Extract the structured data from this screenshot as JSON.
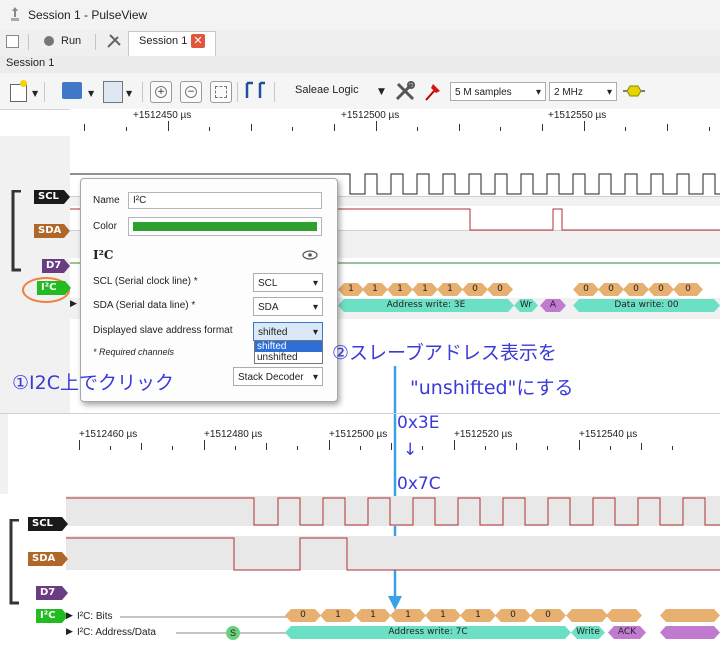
{
  "window": {
    "title": "Session 1 - PulseView"
  },
  "tabs": {
    "run_label": "Run",
    "session_tab": "Session 1"
  },
  "session_bar": {
    "label": "Session 1"
  },
  "toolbar": {
    "device": "Saleae Logic",
    "samples": "5 M samples",
    "rate": "2 MHz"
  },
  "top_ruler": {
    "ticks": [
      "+1512450 µs",
      "+1512500 µs",
      "+1512550 µs"
    ]
  },
  "top_traces": {
    "scl": "SCL",
    "sda": "SDA",
    "d7": "D7",
    "i2c": "I²C",
    "bits": [
      "1",
      "1",
      "1",
      "1",
      "1",
      "0",
      "0",
      "0",
      "0",
      "0",
      "0",
      "0"
    ],
    "address": "Address write: 3E",
    "wr": "Wr",
    "ack": "A",
    "data": "Data write: 00"
  },
  "popup": {
    "name_label": "Name",
    "name_value": "I²C",
    "color_label": "Color",
    "color_value": "#2ea02e",
    "decoder_title": "I²C",
    "scl_label": "SCL (Serial clock line) *",
    "scl_value": "SCL",
    "sda_label": "SDA (Serial data line) *",
    "sda_value": "SDA",
    "addr_label": "Displayed slave address format",
    "addr_value": "shifted",
    "options": [
      "shifted",
      "unshifted"
    ],
    "required": "* Required channels",
    "stack_button": "Stack Decoder"
  },
  "annotations": {
    "step1": "①I2C上でクリック",
    "step2_line1": "②スレーブアドレス表示を",
    "step2_line2": "\"unshifted\"にする",
    "from_value": "0x3E",
    "arrow": "↓",
    "to_value": "0x7C"
  },
  "bottom_ruler": {
    "ticks": [
      "+1512460 µs",
      "+1512480 µs",
      "+1512500 µs",
      "+1512520 µs",
      "+1512540 µs"
    ]
  },
  "bottom_traces": {
    "scl": "SCL",
    "sda": "SDA",
    "d7": "D7",
    "i2c": "I²C",
    "row_bits_label": "I²C: Bits",
    "row_addr_label": "I²C: Address/Data",
    "start": "S",
    "bits": [
      "0",
      "1",
      "1",
      "1",
      "1",
      "1",
      "0",
      "0"
    ],
    "address": "Address write: 7C",
    "write": "Write",
    "ack": "ACK"
  },
  "colors": {
    "accent": "#3a3ad8",
    "circle": "#f08040",
    "green": "#2ea02e"
  }
}
